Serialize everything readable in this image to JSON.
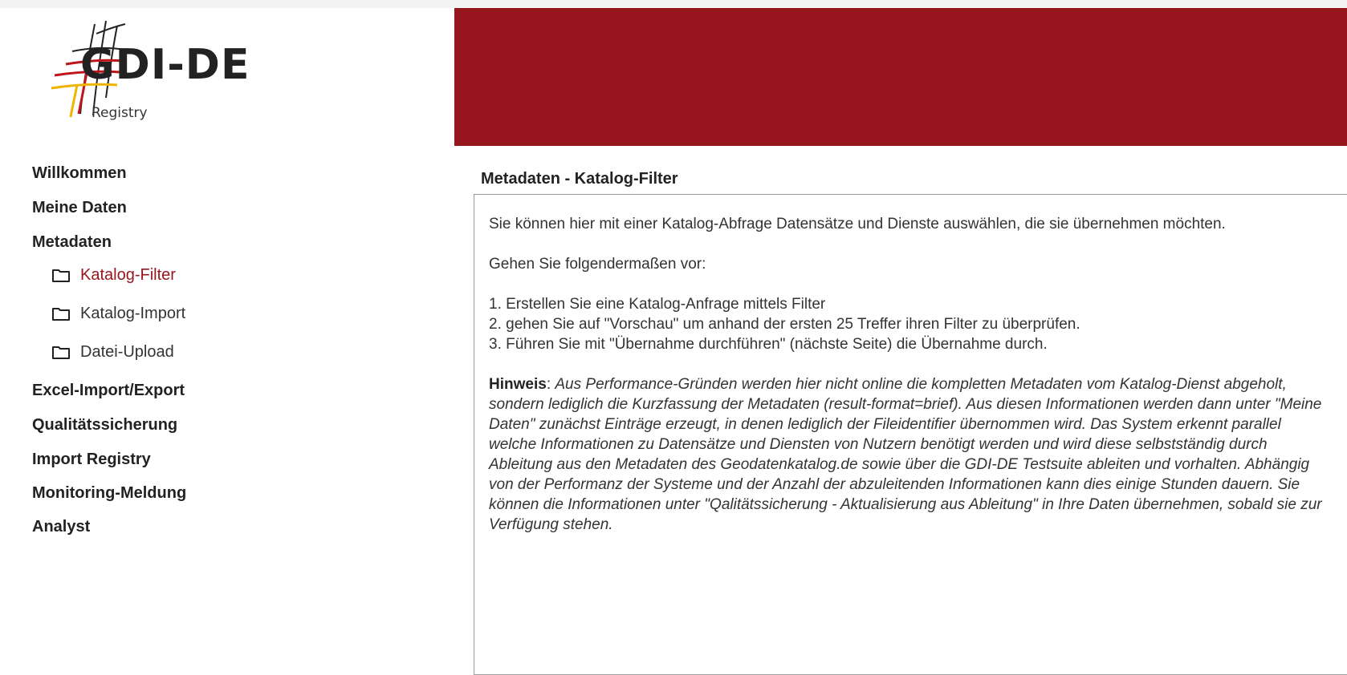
{
  "logo": {
    "name": "GDI-DE",
    "subtitle": "Registry"
  },
  "colors": {
    "brand": "#97151d",
    "text": "#333333",
    "border": "#9a9a9a"
  },
  "sidebar": {
    "items": [
      {
        "label": "Willkommen"
      },
      {
        "label": "Meine Daten"
      },
      {
        "label": "Metadaten"
      },
      {
        "label": "Excel-Import/Export"
      },
      {
        "label": "Qualitätssicherung"
      },
      {
        "label": "Import Registry"
      },
      {
        "label": "Monitoring-Meldung"
      },
      {
        "label": "Analyst"
      }
    ],
    "subitems": [
      {
        "label": "Katalog-Filter",
        "icon": "folder-icon",
        "active": true
      },
      {
        "label": "Katalog-Import",
        "icon": "folder-icon",
        "active": false
      },
      {
        "label": "Datei-Upload",
        "icon": "folder-icon",
        "active": false
      }
    ]
  },
  "main": {
    "title": "Metadaten - Katalog-Filter",
    "intro": "Sie können hier mit einer Katalog-Abfrage Datensätze und Dienste auswählen, die sie übernehmen möchten.",
    "instructions_heading": "Gehen Sie folgendermaßen vor:",
    "steps": [
      "1. Erstellen Sie eine Katalog-Anfrage mittels Filter",
      "2. gehen Sie auf \"Vorschau\" um anhand der ersten 25 Treffer ihren Filter zu überprüfen.",
      "3. Führen Sie mit \"Übernahme durchführen\" (nächste Seite) die Übernahme durch."
    ],
    "hint_label": "Hinweis",
    "hint_text": "Aus Performance-Gründen werden hier nicht online die kompletten Metadaten vom Katalog-Dienst abgeholt, sondern lediglich die Kurzfassung der Metadaten (result-format=brief). Aus diesen Informationen werden dann unter \"Meine Daten\" zunächst Einträge erzeugt, in denen lediglich der Fileidentifier übernommen wird. Das System erkennt parallel welche Informationen zu Datensätze und Diensten von Nutzern benötigt werden und wird diese selbstständig durch Ableitung aus den Metadaten des Geodatenkatalog.de sowie über die GDI-DE Testsuite ableiten und vorhalten. Abhängig von der Performanz der Systeme und der Anzahl der abzuleitenden Informationen kann dies einige Stunden dauern. Sie können die Informationen unter \"Qalitätssicherung - Aktualisierung aus Ableitung\" in Ihre Daten übernehmen, sobald sie zur Verfügung stehen."
  }
}
